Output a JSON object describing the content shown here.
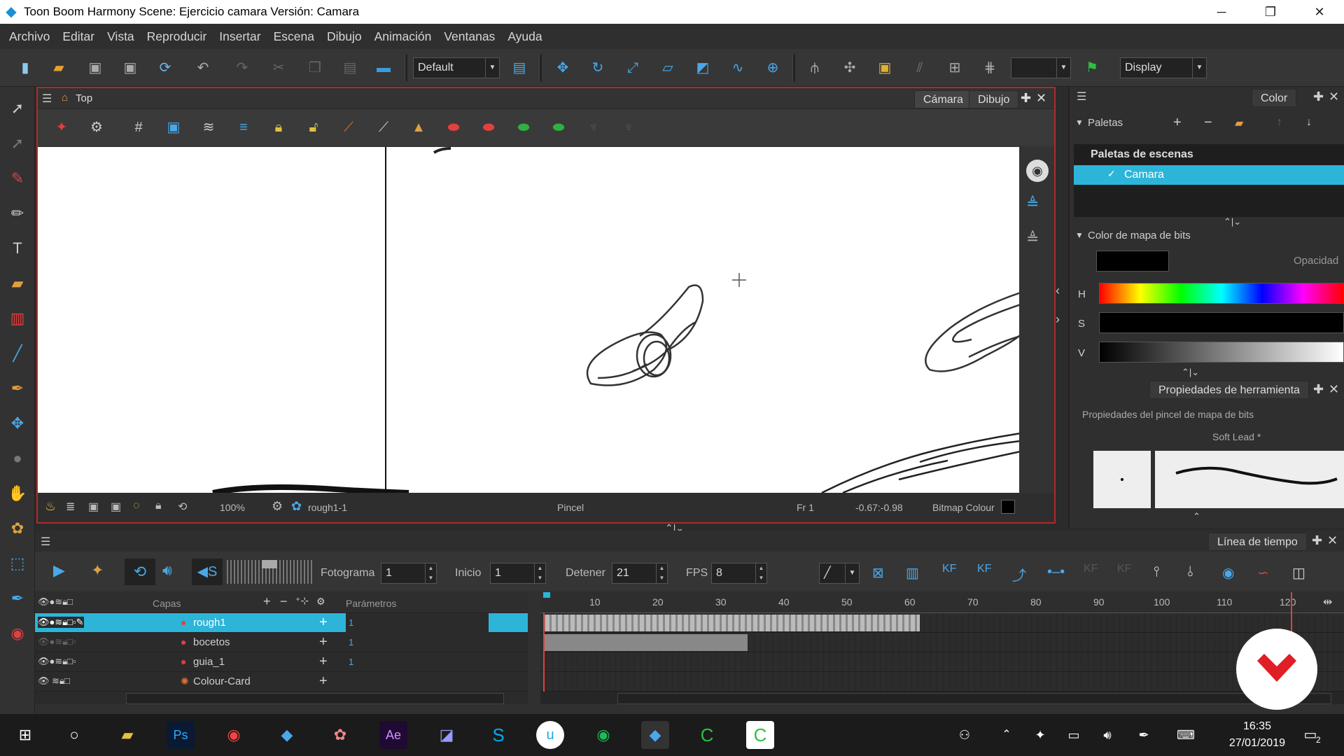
{
  "window": {
    "title": "Toon Boom Harmony Scene: Ejercicio camara Versión: Camara",
    "min_icon": "─",
    "restore_icon": "❐",
    "close_icon": "✕"
  },
  "menu": [
    "Archivo",
    "Editar",
    "Vista",
    "Reproducir",
    "Insertar",
    "Escena",
    "Dibujo",
    "Animación",
    "Ventanas",
    "Ayuda"
  ],
  "toolbar": {
    "workspace": "Default",
    "display": "Display"
  },
  "camera_view": {
    "view_name": "Top",
    "tabs": [
      "Cámara",
      "Dibujo"
    ],
    "status": {
      "zoom": "100%",
      "drawing": "rough1-1",
      "tool": "Pincel",
      "frame": "Fr 1",
      "coords": "-0.67:-0.98",
      "bitmap_colour": "Bitmap Colour"
    }
  },
  "color_panel": {
    "tab": "Color",
    "palettes_label": "Paletas",
    "scene_palettes": "Paletas de escenas",
    "palette_item": "Camara",
    "bitmap_color_label": "Color de mapa de bits",
    "opacity_label": "Opacidad",
    "h_label": "H",
    "s_label": "S",
    "v_label": "V",
    "current_color": "#000000"
  },
  "tool_props": {
    "tab": "Propiedades de herramienta",
    "title": "Propiedades del pincel de mapa de bits",
    "preset": "Soft Lead *"
  },
  "timeline": {
    "tab": "Línea de tiempo",
    "fotograma_label": "Fotograma",
    "fotograma": "1",
    "inicio_label": "Inicio",
    "inicio": "1",
    "detener_label": "Detener",
    "detener": "21",
    "fps_label": "FPS",
    "fps": "8",
    "layers_label": "Capas",
    "params_label": "Parámetros",
    "layers": [
      {
        "name": "rough1",
        "value": "1"
      },
      {
        "name": "bocetos",
        "value": "1"
      },
      {
        "name": "guia_1",
        "value": "1"
      },
      {
        "name": "Colour-Card",
        "value": ""
      }
    ],
    "ruler": [
      "10",
      "20",
      "30",
      "40",
      "50",
      "60",
      "70",
      "80",
      "90",
      "100",
      "110",
      "120"
    ]
  },
  "taskbar": {
    "time": "16:35",
    "date": "27/01/2019",
    "notifications": "2"
  }
}
